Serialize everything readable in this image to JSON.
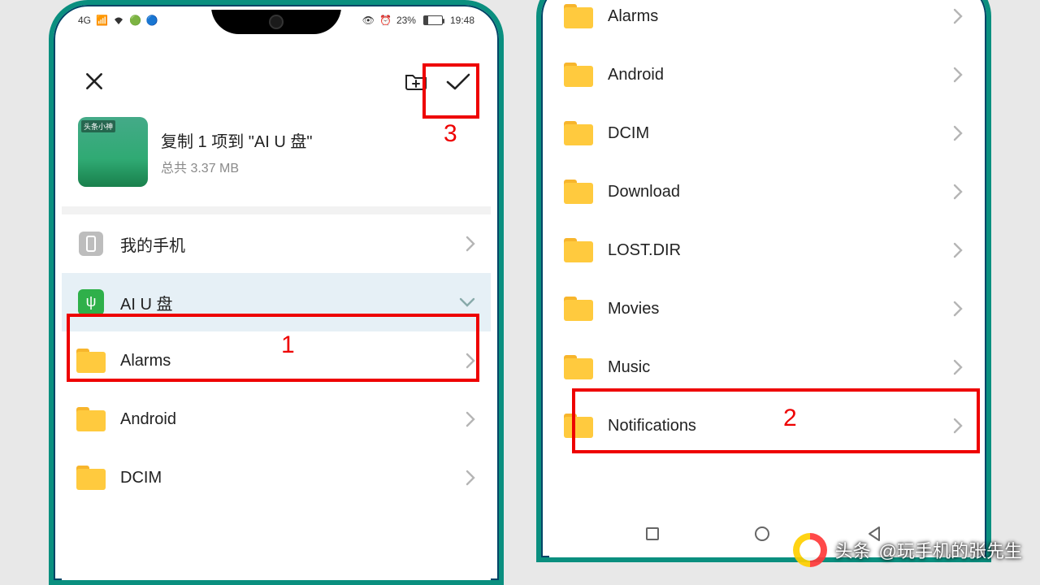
{
  "statusbar": {
    "network": "4G",
    "battery_pct": "23%",
    "time": "19:48"
  },
  "copy": {
    "title": "复制 1 项到 \"AI U 盘\"",
    "subtitle": "总共 3.37 MB",
    "thumb_label": "头条小神"
  },
  "locations": {
    "phone": "我的手机",
    "usb": "AI U 盘"
  },
  "folders_left": [
    {
      "name": "Alarms"
    },
    {
      "name": "Android"
    },
    {
      "name": "DCIM"
    }
  ],
  "folders_right": [
    {
      "name": "Alarms"
    },
    {
      "name": "Android"
    },
    {
      "name": "DCIM"
    },
    {
      "name": "Download"
    },
    {
      "name": "LOST.DIR"
    },
    {
      "name": "Movies"
    },
    {
      "name": "Music"
    },
    {
      "name": "Notifications"
    }
  ],
  "callouts": {
    "one": "1",
    "two": "2",
    "three": "3"
  },
  "watermark": {
    "prefix": "头条",
    "text": "@玩手机的张先生"
  }
}
